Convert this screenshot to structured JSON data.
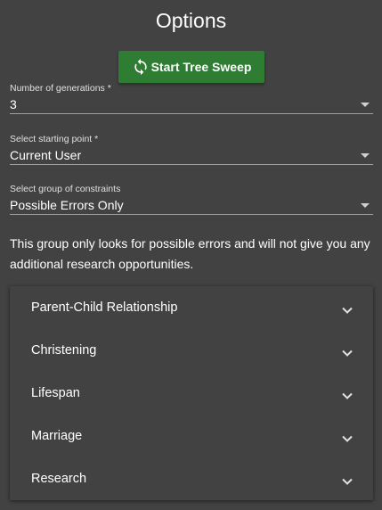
{
  "header": {
    "title": "Options"
  },
  "sweep_button": {
    "label": "Start Tree Sweep",
    "icon": "refresh-icon",
    "color": "#2e7d32"
  },
  "fields": {
    "generations": {
      "label": "Number of generations *",
      "value": "3"
    },
    "starting_point": {
      "label": "Select starting point *",
      "value": "Current User"
    },
    "constraints": {
      "label": "Select group of constraints",
      "value": "Possible Errors Only"
    }
  },
  "description": "This group only looks for possible errors and will not give you any additional research opportunities.",
  "accordion": {
    "items": [
      {
        "label": "Parent-Child Relationship"
      },
      {
        "label": "Christening"
      },
      {
        "label": "Lifespan"
      },
      {
        "label": "Marriage"
      },
      {
        "label": "Research"
      }
    ]
  }
}
